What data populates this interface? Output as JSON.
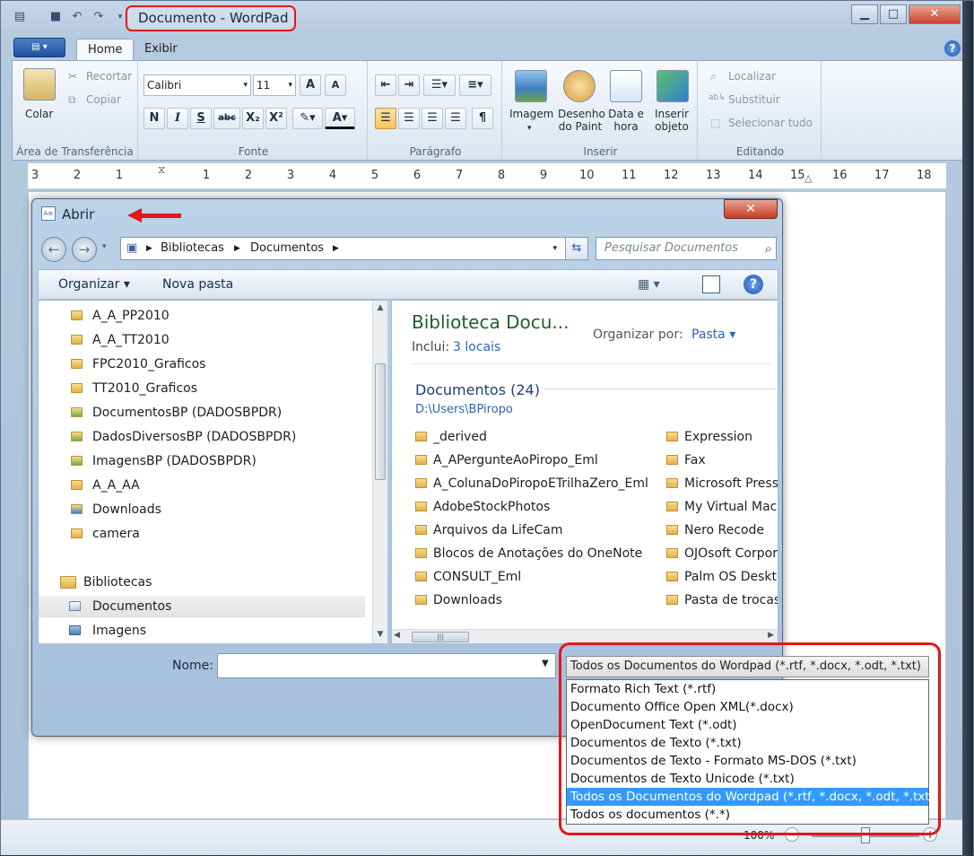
{
  "window": {
    "title": "Documento - WordPad",
    "caption_min": "▁",
    "caption_max": "□",
    "caption_close": "✕"
  },
  "ribbon": {
    "tabs": [
      "Home",
      "Exibir"
    ],
    "groups": {
      "clipboard": {
        "label": "Área de Transferência",
        "paste": "Colar",
        "cut": "Recortar",
        "copy": "Copiar"
      },
      "font": {
        "label": "Fonte",
        "family": "Calibri",
        "size": "11",
        "grow": "A",
        "shrink": "A",
        "bold": "N",
        "italic": "I",
        "underline": "S",
        "strike": "abc",
        "subscript": "X₂",
        "superscript": "X²",
        "color": "A"
      },
      "paragraph": {
        "label": "Parágrafo"
      },
      "insert": {
        "label": "Inserir",
        "image": "Imagem",
        "paint": [
          "Desenho",
          "do Paint"
        ],
        "datetime": [
          "Data e",
          "hora"
        ],
        "object": [
          "Inserir",
          "objeto"
        ]
      },
      "editing": {
        "label": "Editando",
        "find": "Localizar",
        "replace": "Substituir",
        "select_all": "Selecionar tudo"
      }
    }
  },
  "ruler": {
    "numbers": [
      "3",
      "2",
      "1",
      "1",
      "2",
      "3",
      "4",
      "5",
      "6",
      "7",
      "8",
      "9",
      "10",
      "11",
      "12",
      "13",
      "14",
      "15",
      "16",
      "17",
      "18"
    ]
  },
  "status": {
    "zoom": "100%",
    "zoom_level": 0.5
  },
  "dialog": {
    "title": "Abrir",
    "close": "✕",
    "breadcrumb": [
      "Bibliotecas",
      "Documentos"
    ],
    "search_placeholder": "Pesquisar Documentos",
    "commands": {
      "organize": "Organizar ▾",
      "new_folder": "Nova pasta"
    },
    "nav_tree": [
      {
        "label": "A_A_PP2010",
        "icon": "folder-icon"
      },
      {
        "label": "A_A_TT2010",
        "icon": "folder-icon"
      },
      {
        "label": "FPC2010_Graficos",
        "icon": "folder-icon"
      },
      {
        "label": "TT2010_Graficos",
        "icon": "folder-icon"
      },
      {
        "label": "DocumentosBP (DADOSBPDR)",
        "icon": "shared-folder-icon"
      },
      {
        "label": "DadosDiversosBP (DADOSBPDR)",
        "icon": "shared-folder-icon"
      },
      {
        "label": "ImagensBP (DADOSBPDR)",
        "icon": "shared-folder-icon"
      },
      {
        "label": "A_A_AA",
        "icon": "folder-icon"
      },
      {
        "label": "Downloads",
        "icon": "downloads-folder-icon"
      },
      {
        "label": "camera",
        "icon": "folder-icon"
      },
      {
        "label": "",
        "icon": ""
      },
      {
        "label": "Bibliotecas",
        "icon": "libraries-icon"
      },
      {
        "label": "Documentos",
        "icon": "documents-library-icon"
      },
      {
        "label": "Imagens",
        "icon": "pictures-library-icon"
      }
    ],
    "library": {
      "title": "Biblioteca Docu...",
      "includes_label": "Inclui:",
      "includes_link": "3 locais",
      "arrange_label": "Organizar por:",
      "arrange_value": "Pasta ▾",
      "section_title": "Documentos (24)",
      "section_path": "D:\\Users\\BPiropo"
    },
    "files_col1": [
      "_derived",
      "A_APergunteAoPiropo_Eml",
      "A_ColunaDoPiropoETrilhaZero_Eml",
      "AdobeStockPhotos",
      "Arquivos da LifeCam",
      "Blocos de Anotações do OneNote",
      "CONSULT_Eml",
      "Downloads"
    ],
    "files_col2": [
      "Expression",
      "Fax",
      "Microsoft Press",
      "My Virtual Mach",
      "Nero Recode",
      "OJOsoft Corpora",
      "Palm OS Deskto",
      "Pasta de trocas"
    ],
    "filename_label": "Nome:",
    "filename_value": "",
    "filetype_selected": "Todos os Documentos do Wordpad (*.rtf, *.docx, *.odt, *.txt)",
    "filetype_options": [
      "Formato Rich Text (*.rtf)",
      "Documento Office Open XML(*.docx)",
      "OpenDocument Text (*.odt)",
      "Documentos de Texto (*.txt)",
      "Documentos de Texto - Formato MS-DOS (*.txt)",
      "Documentos de Texto Unicode (*.txt)",
      "Todos os Documentos do Wordpad (*.rtf, *.docx, *.odt, *.txt)",
      "Todos os documentos (*.*)"
    ],
    "filetype_selected_index": 6
  },
  "colors": {
    "annotation_red": "#e21717",
    "selection_blue": "#3399ff",
    "library_title_green": "#1f5f2f",
    "link_blue": "#2a64b8"
  }
}
